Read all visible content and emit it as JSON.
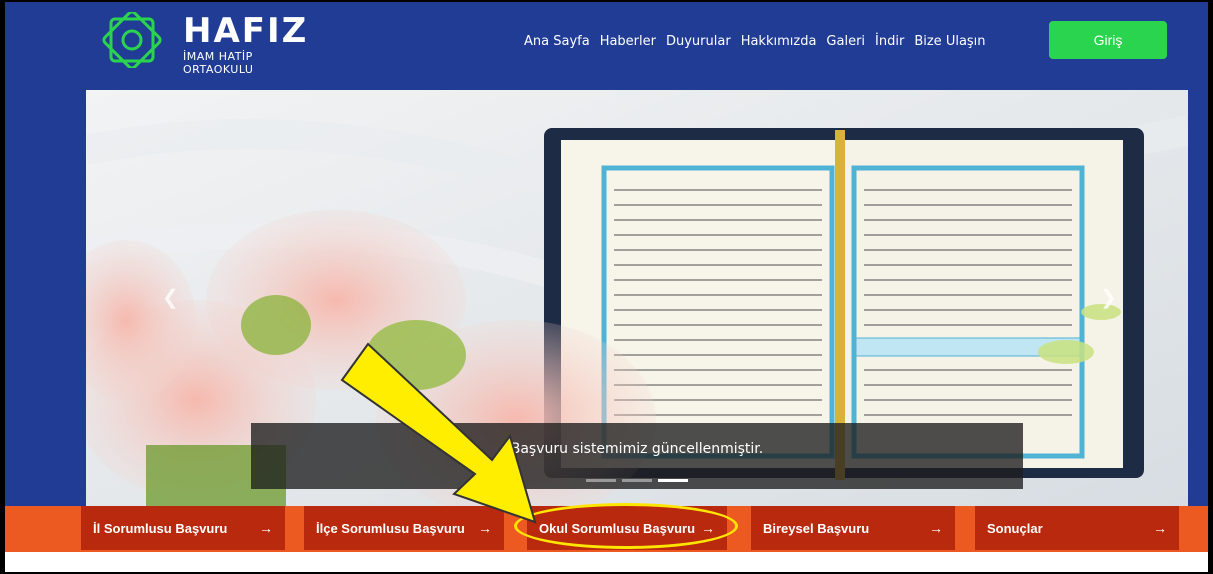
{
  "header": {
    "logo_title": "HAFIZ",
    "logo_subtitle": "İMAM HATİP ORTAOKULU",
    "nav": [
      "Ana Sayfa",
      "Haberler",
      "Duyurular",
      "Hakkımızda",
      "Galeri",
      "İndir",
      "Bize Ulaşın"
    ],
    "login_label": "Giriş"
  },
  "hero": {
    "caption": "Başvuru sistemimiz güncellenmiştir.",
    "slide_count": 3,
    "active_slide": 3,
    "prev_icon": "chevron-left-icon",
    "next_icon": "chevron-right-icon"
  },
  "actions": [
    {
      "label": "İl Sorumlusu Başvuru",
      "arrow": "→"
    },
    {
      "label": "İlçe Sorumlusu Başvuru",
      "arrow": "→"
    },
    {
      "label": "Okul Sorumlusu Başvuru",
      "arrow": "→"
    },
    {
      "label": "Bireysel Başvuru",
      "arrow": "→"
    },
    {
      "label": "Sonuçlar",
      "arrow": "→"
    }
  ],
  "colors": {
    "header_bg": "#213c95",
    "login_bg": "#2bd44e",
    "action_bar_bg": "#ec5a22",
    "action_button_bg": "#b8290d",
    "annotation": "#ffe500"
  }
}
